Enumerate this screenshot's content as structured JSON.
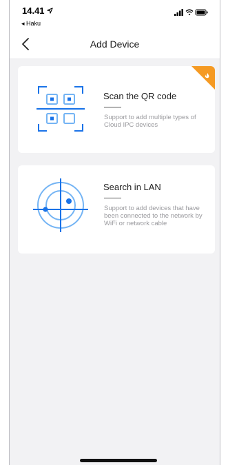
{
  "status_bar": {
    "time": "14.41",
    "back_app": "◂ Haku",
    "icons": [
      "location-arrow-icon",
      "signal-icon",
      "wifi-icon",
      "battery-icon"
    ]
  },
  "nav": {
    "title": "Add Device",
    "back_icon": "chevron-left-icon"
  },
  "options": [
    {
      "title": "Scan the QR code",
      "description": "Support to add multiple types of Cloud IPC devices",
      "icon": "qr-scan-icon",
      "badge_icon": "hot-flame-icon"
    },
    {
      "title": "Search in LAN",
      "description": "Support to add devices that have been connected to the network by WiFi or network cable",
      "icon": "radar-search-icon"
    }
  ],
  "colors": {
    "accent": "#1a73e8",
    "accent_light": "#74b4f4",
    "badge": "#f59a23",
    "background": "#f2f2f4"
  }
}
